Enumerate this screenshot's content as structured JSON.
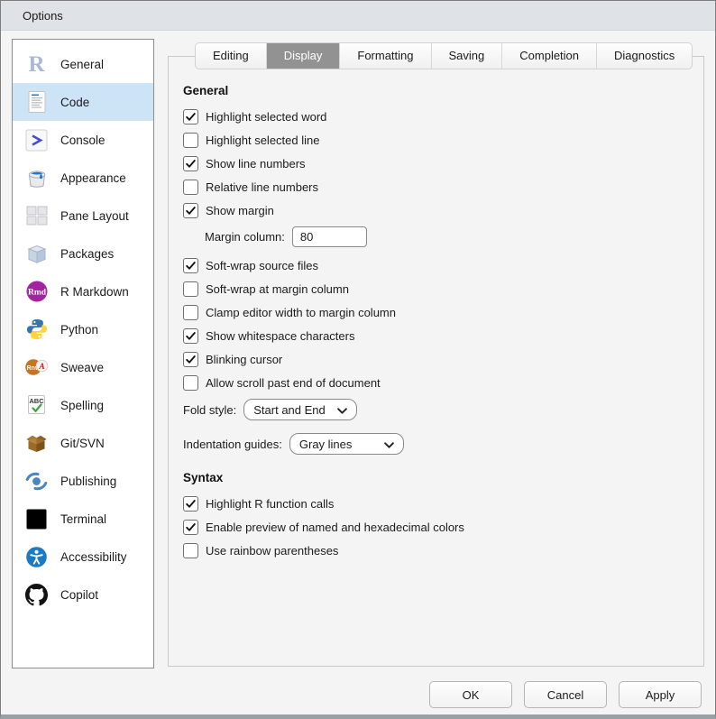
{
  "window": {
    "title": "Options"
  },
  "colors": {
    "selected_item_bg": "#cde4f7",
    "active_tab_bg": "#929292",
    "titlebar_bg": "#dfe2e6",
    "rmarkdown_badge": "#a224a0",
    "python_blue": "#3874a8",
    "python_yellow": "#ffd43b",
    "accessibility_blue": "#1a7ac4",
    "publishing_blue": "#4a84c4"
  },
  "sidebar": {
    "items": [
      {
        "label": "General",
        "icon": "r-logo-icon",
        "selected": false
      },
      {
        "label": "Code",
        "icon": "code-document-icon",
        "selected": true
      },
      {
        "label": "Console",
        "icon": "console-prompt-icon",
        "selected": false
      },
      {
        "label": "Appearance",
        "icon": "paint-bucket-icon",
        "selected": false
      },
      {
        "label": "Pane Layout",
        "icon": "pane-grid-icon",
        "selected": false
      },
      {
        "label": "Packages",
        "icon": "package-box-icon",
        "selected": false
      },
      {
        "label": "R Markdown",
        "icon": "rmarkdown-icon",
        "selected": false
      },
      {
        "label": "Python",
        "icon": "python-icon",
        "selected": false
      },
      {
        "label": "Sweave",
        "icon": "sweave-icon",
        "selected": false
      },
      {
        "label": "Spelling",
        "icon": "spellcheck-icon",
        "selected": false
      },
      {
        "label": "Git/SVN",
        "icon": "git-box-icon",
        "selected": false
      },
      {
        "label": "Publishing",
        "icon": "publishing-icon",
        "selected": false
      },
      {
        "label": "Terminal",
        "icon": "terminal-icon",
        "selected": false
      },
      {
        "label": "Accessibility",
        "icon": "accessibility-icon",
        "selected": false
      },
      {
        "label": "Copilot",
        "icon": "github-icon",
        "selected": false
      }
    ]
  },
  "tabs": [
    {
      "label": "Editing",
      "selected": false
    },
    {
      "label": "Display",
      "selected": true
    },
    {
      "label": "Formatting",
      "selected": false
    },
    {
      "label": "Saving",
      "selected": false
    },
    {
      "label": "Completion",
      "selected": false
    },
    {
      "label": "Diagnostics",
      "selected": false
    }
  ],
  "content": {
    "sections": [
      {
        "heading": "General",
        "rows": [
          {
            "type": "checkbox",
            "label": "Highlight selected word",
            "checked": true
          },
          {
            "type": "checkbox",
            "label": "Highlight selected line",
            "checked": false
          },
          {
            "type": "checkbox",
            "label": "Show line numbers",
            "checked": true
          },
          {
            "type": "checkbox",
            "label": "Relative line numbers",
            "checked": false
          },
          {
            "type": "checkbox",
            "label": "Show margin",
            "checked": true
          },
          {
            "type": "text-input",
            "label": "Margin column:",
            "value": "80",
            "indent": true
          },
          {
            "type": "checkbox",
            "label": "Soft-wrap source files",
            "checked": true
          },
          {
            "type": "checkbox",
            "label": "Soft-wrap at margin column",
            "checked": false
          },
          {
            "type": "checkbox",
            "label": "Clamp editor width to margin column",
            "checked": false
          },
          {
            "type": "checkbox",
            "label": "Show whitespace characters",
            "checked": true
          },
          {
            "type": "checkbox",
            "label": "Blinking cursor",
            "checked": true
          },
          {
            "type": "checkbox",
            "label": "Allow scroll past end of document",
            "checked": false
          },
          {
            "type": "select",
            "label": "Fold style:",
            "value": "Start and End",
            "width": 126
          },
          {
            "type": "select",
            "label": "Indentation guides:",
            "value": "Gray lines",
            "width": 127,
            "spaced": true
          }
        ]
      },
      {
        "heading": "Syntax",
        "rows": [
          {
            "type": "checkbox",
            "label": "Highlight R function calls",
            "checked": true
          },
          {
            "type": "checkbox",
            "label": "Enable preview of named and hexadecimal colors",
            "checked": true
          },
          {
            "type": "checkbox",
            "label": "Use rainbow parentheses",
            "checked": false
          }
        ]
      }
    ]
  },
  "footer": {
    "buttons": [
      {
        "label": "OK",
        "name": "ok-button"
      },
      {
        "label": "Cancel",
        "name": "cancel-button"
      },
      {
        "label": "Apply",
        "name": "apply-button"
      }
    ]
  }
}
